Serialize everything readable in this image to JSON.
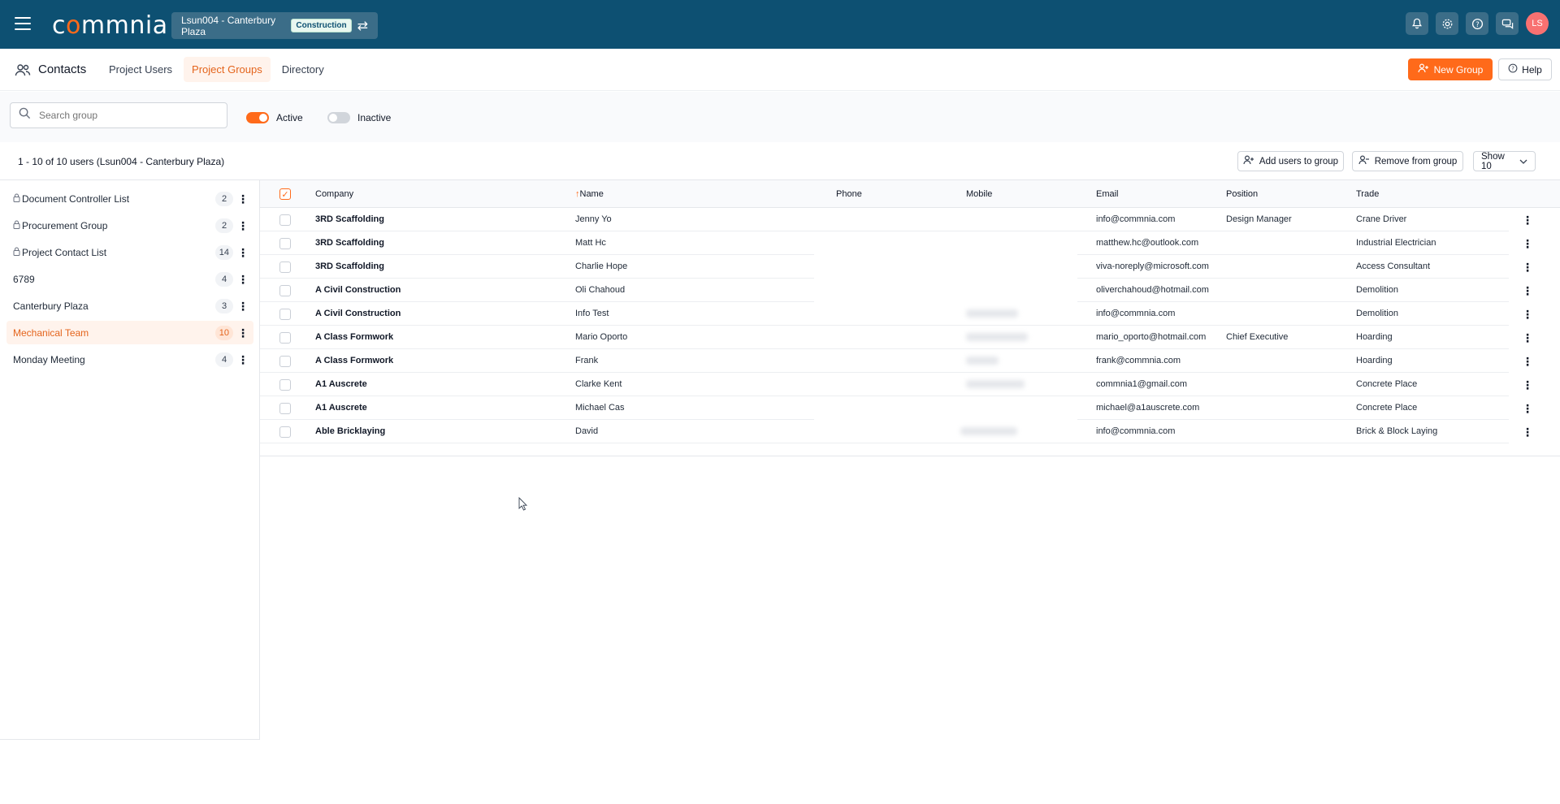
{
  "topbar": {
    "logo": "commnia",
    "project_name": "Lsun004 - Canterbury Plaza",
    "project_badge": "Construction",
    "avatar_initials": "LS"
  },
  "nav": {
    "title": "Contacts",
    "tabs": [
      {
        "label": "Project Users",
        "active": false
      },
      {
        "label": "Project Groups",
        "active": true
      },
      {
        "label": "Directory",
        "active": false
      }
    ],
    "new_group_label": "New Group",
    "help_label": "Help"
  },
  "filters": {
    "search_placeholder": "Search group",
    "active_label": "Active",
    "inactive_label": "Inactive"
  },
  "summary": {
    "count_text": "1 - 10 of 10 users (Lsun004 - Canterbury Plaza)",
    "add_users_label": "Add users to group",
    "remove_label": "Remove from group",
    "show_label": "Show 10"
  },
  "groups": [
    {
      "name": "Document Controller List",
      "count": "2",
      "locked": true
    },
    {
      "name": "Procurement Group",
      "count": "2",
      "locked": true
    },
    {
      "name": "Project Contact List",
      "count": "14",
      "locked": true
    },
    {
      "name": "6789",
      "count": "4",
      "locked": false
    },
    {
      "name": "Canterbury Plaza",
      "count": "3",
      "locked": false
    },
    {
      "name": "Mechanical Team",
      "count": "10",
      "locked": false,
      "active": true
    },
    {
      "name": "Monday Meeting",
      "count": "4",
      "locked": false
    }
  ],
  "table": {
    "headers": {
      "company": "Company",
      "name": "Name",
      "sort_arrow": "↑",
      "phone": "Phone",
      "mobile": "Mobile",
      "email": "Email",
      "position": "Position",
      "trade": "Trade"
    },
    "rows": [
      {
        "company": "3RD Scaffolding",
        "name": "Jenny Yo",
        "email": "info@commnia.com",
        "position": "Design Manager",
        "trade": "Crane Driver"
      },
      {
        "company": "3RD Scaffolding",
        "name": "Matt Hc",
        "email": "matthew.hc@outlook.com",
        "position": "",
        "trade": "Industrial Electrician"
      },
      {
        "company": "3RD Scaffolding",
        "name": "Charlie Hope",
        "email": "viva-noreply@microsoft.com",
        "position": "",
        "trade": "Access Consultant"
      },
      {
        "company": "A Civil Construction",
        "name": "Oli Chahoud",
        "email": "oliverchahoud@hotmail.com",
        "position": "",
        "trade": "Demolition"
      },
      {
        "company": "A Civil Construction",
        "name": "Info Test",
        "email": "info@commnia.com",
        "position": "",
        "trade": "Demolition"
      },
      {
        "company": "A Class Formwork",
        "name": "Mario Oporto",
        "email": "mario_oporto@hotmail.com",
        "position": "Chief Executive",
        "trade": "Hoarding"
      },
      {
        "company": "A Class Formwork",
        "name": "Frank",
        "email": "frank@commnia.com",
        "position": "",
        "trade": "Hoarding"
      },
      {
        "company": "A1 Auscrete",
        "name": "Clarke Kent",
        "email": "commnia1@gmail.com",
        "position": "",
        "trade": "Concrete Place"
      },
      {
        "company": "A1 Auscrete",
        "name": "Michael Cas",
        "email": "michael@a1auscrete.com",
        "position": "",
        "trade": "Concrete Place"
      },
      {
        "company": "Able Bricklaying",
        "name": "David",
        "email": "info@commnia.com",
        "position": "",
        "trade": "Brick & Block Laying"
      }
    ]
  },
  "icons": {
    "menu": "hamburger-icon",
    "swap": "swap-icon",
    "bell": "bell-icon",
    "gear": "gear-icon",
    "help": "help-icon",
    "chat": "chat-icon",
    "search": "search-icon"
  }
}
